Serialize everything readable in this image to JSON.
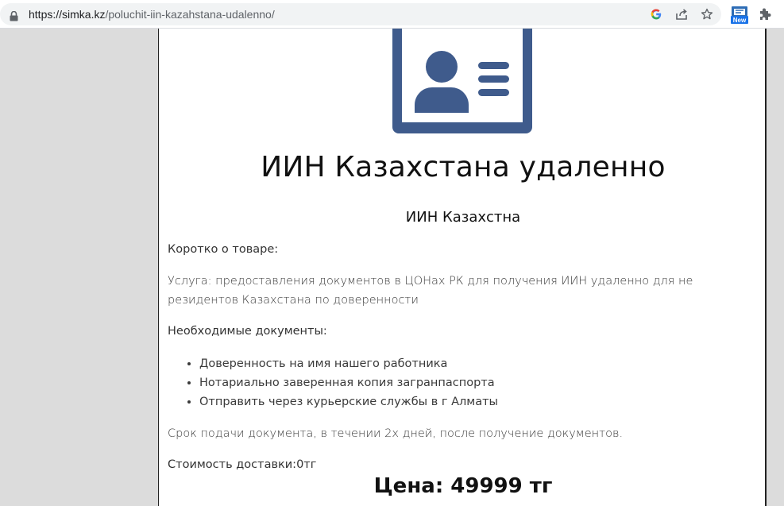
{
  "browser": {
    "url_host": "https://simka.kz",
    "url_path": "/poluchit-iin-kazahstana-udalenno/",
    "extension_badge": "New"
  },
  "colors": {
    "icon_blue": "#3f5b8c"
  },
  "page": {
    "title": "ИИН Казахстана удаленно",
    "subtitle": "ИИН Казахстна",
    "short_label": "Коротко о товаре:",
    "service_text": "Услуга: предоставления документов в ЦОНах РК для получения ИИН удаленно для не резидентов Казахстана по доверенности",
    "required_label": "Необходимые документы:",
    "required_items": [
      "Доверенность на имя нашего работника",
      "Нотариально заверенная копия загранпаспорта",
      "Отправить через курьерские службы в г Алматы"
    ],
    "deadline_text": "Срок подачи документа, в течении 2х дней, после получение документов.",
    "delivery_text": "Стоимость доставки:0тг",
    "price_text": "Цена: 49999 тг"
  }
}
